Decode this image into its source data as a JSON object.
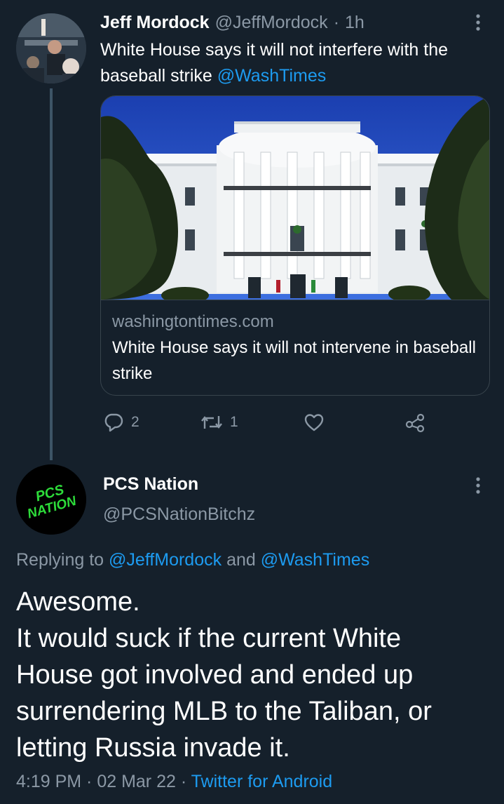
{
  "parent_tweet": {
    "author_name": "Jeff Mordock",
    "handle": "@JeffMordock",
    "separator": "·",
    "time": "1h",
    "text": "White House says it will not interfere with the baseball strike ",
    "mention": "@WashTimes",
    "card": {
      "domain": "washingtontimes.com",
      "title": "White House says it will not intervene in baseball strike"
    },
    "actions": {
      "reply_count": "2",
      "retweet_count": "1",
      "like_count": "",
      "icons": [
        "reply-icon",
        "retweet-icon",
        "like-icon",
        "share-icon"
      ]
    }
  },
  "reply_tweet": {
    "author_name": "PCS Nation",
    "handle": "@PCSNationBitchz",
    "avatar_logo_text": [
      "PCS",
      "NATION"
    ],
    "replying_prefix": "Replying to ",
    "replying_user1": "@JeffMordock",
    "replying_and": " and ",
    "replying_user2": "@WashTimes",
    "body_lines": [
      "Awesome.",
      "It would suck if the current White",
      "House got involved and ended up",
      "surrendering MLB to the Taliban, or",
      "letting Russia invade it."
    ],
    "time": "4:19 PM",
    "dot": " · ",
    "date": "02 Mar 22",
    "client": "Twitter for Android"
  },
  "colors": {
    "background": "#15202b",
    "text": "#ffffff",
    "secondary": "#8b98a5",
    "accent": "#1d9bf0",
    "border": "#38444d",
    "avatar_logo": "#2ddc3a"
  }
}
